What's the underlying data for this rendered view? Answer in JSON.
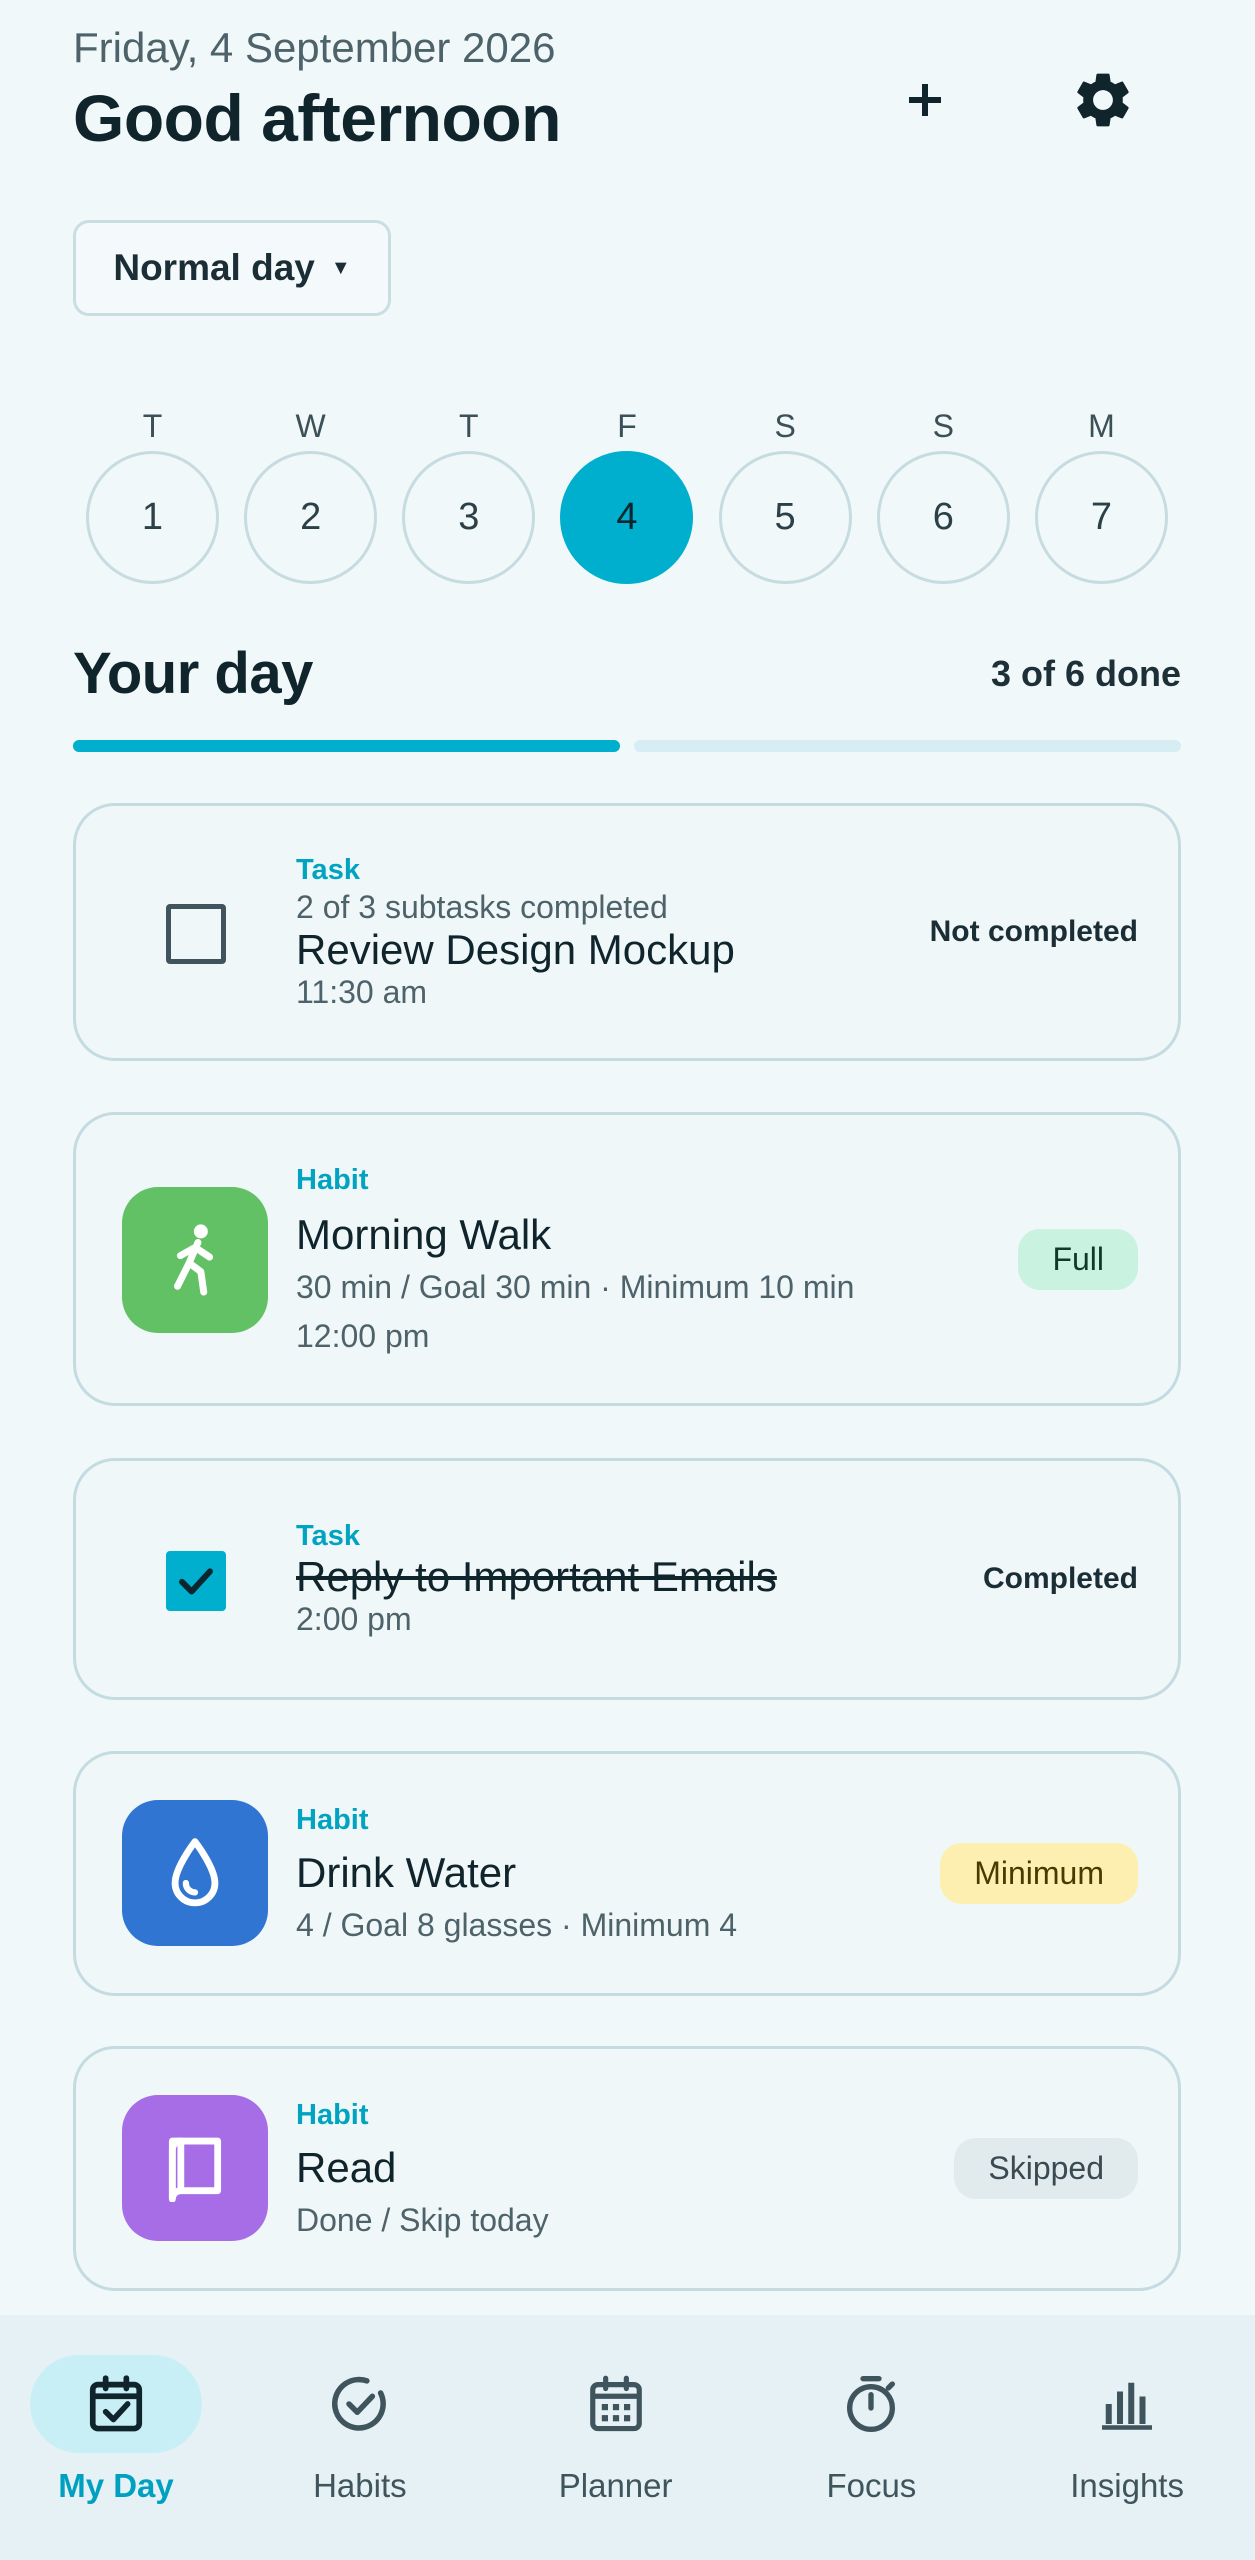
{
  "header": {
    "date": "Friday, 4 September 2026",
    "greeting": "Good afternoon",
    "add_icon": "plus-icon",
    "settings_icon": "gear-icon"
  },
  "mode": {
    "selected": "Normal day"
  },
  "week": [
    {
      "letter": "T",
      "num": "1",
      "selected": false
    },
    {
      "letter": "W",
      "num": "2",
      "selected": false
    },
    {
      "letter": "T",
      "num": "3",
      "selected": false
    },
    {
      "letter": "F",
      "num": "4",
      "selected": true
    },
    {
      "letter": "S",
      "num": "5",
      "selected": false
    },
    {
      "letter": "S",
      "num": "6",
      "selected": false
    },
    {
      "letter": "M",
      "num": "7",
      "selected": false
    }
  ],
  "yourday": {
    "title": "Your day",
    "count": "3 of 6 done",
    "progress_fraction": 0.5
  },
  "items": [
    {
      "kind": "Task",
      "sub": "2 of 3 subtasks completed",
      "title": "Review Design Mockup",
      "time": "11:30 am",
      "status": "Not completed"
    },
    {
      "kind": "Habit",
      "title": "Morning Walk",
      "detail": "30 min / Goal 30 min · Minimum 10 min",
      "time": "12:00 pm",
      "status": "Full",
      "icon": "walking-person-icon",
      "icon_color": "#62c065",
      "badge_bg": "#c9f2e0"
    },
    {
      "kind": "Task",
      "title": "Reply to Important Emails",
      "time": "2:00 pm",
      "status": "Completed"
    },
    {
      "kind": "Habit",
      "title": "Drink Water",
      "detail": "4 / Goal 8 glasses · Minimum 4",
      "status": "Minimum",
      "icon": "water-drop-icon",
      "icon_color": "#3175d2",
      "badge_bg": "#fcefaf"
    },
    {
      "kind": "Habit",
      "title": "Read",
      "detail": "Done / Skip today",
      "status": "Skipped",
      "icon": "book-icon",
      "icon_color": "#a66de6",
      "badge_bg": "#e1eaed"
    }
  ],
  "nav": [
    {
      "label": "My Day",
      "icon": "calendar-check-icon",
      "active": true
    },
    {
      "label": "Habits",
      "icon": "check-circle-icon",
      "active": false
    },
    {
      "label": "Planner",
      "icon": "calendar-grid-icon",
      "active": false
    },
    {
      "label": "Focus",
      "icon": "stopwatch-icon",
      "active": false
    },
    {
      "label": "Insights",
      "icon": "bar-chart-icon",
      "active": false
    }
  ],
  "colors": {
    "accent": "#00aecd",
    "background": "#f1f8fa",
    "text": "#10242c"
  }
}
